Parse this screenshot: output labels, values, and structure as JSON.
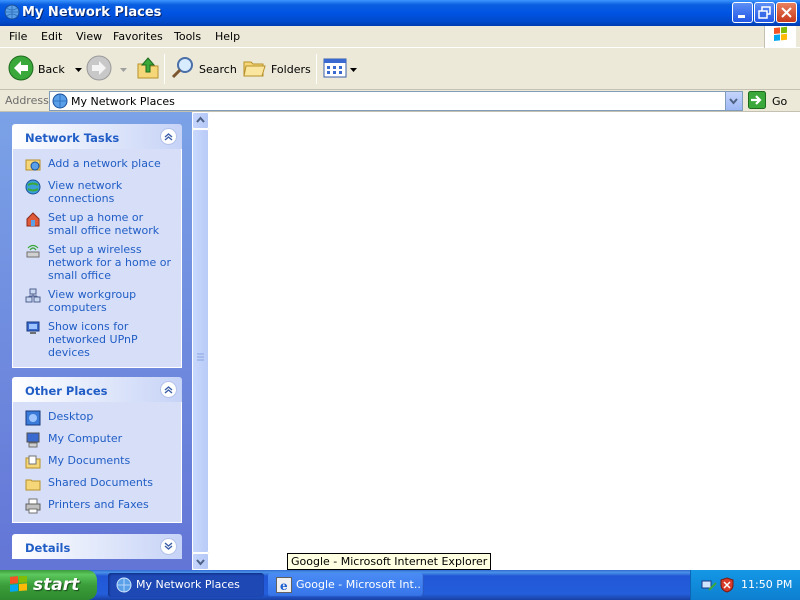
{
  "window": {
    "title": "My Network Places"
  },
  "menu": {
    "items": [
      "File",
      "Edit",
      "View",
      "Favorites",
      "Tools",
      "Help"
    ]
  },
  "toolbar": {
    "back_label": "Back",
    "search_label": "Search",
    "folders_label": "Folders"
  },
  "address": {
    "label": "Address",
    "value": "My Network Places",
    "go_label": "Go"
  },
  "network_tasks": {
    "title": "Network Tasks",
    "items": [
      {
        "label": "Add a network place",
        "icon": "add-network-place-icon"
      },
      {
        "label": "View network connections",
        "icon": "network-connections-icon"
      },
      {
        "label": "Set up a home or small office network",
        "icon": "home-network-icon"
      },
      {
        "label": "Set up a wireless network for a home or small office",
        "icon": "wireless-network-icon"
      },
      {
        "label": "View workgroup computers",
        "icon": "workgroup-icon"
      },
      {
        "label": "Show icons for networked UPnP devices",
        "icon": "upnp-icon"
      }
    ]
  },
  "other_places": {
    "title": "Other Places",
    "items": [
      {
        "label": "Desktop",
        "icon": "desktop-icon"
      },
      {
        "label": "My Computer",
        "icon": "my-computer-icon"
      },
      {
        "label": "My Documents",
        "icon": "my-documents-icon"
      },
      {
        "label": "Shared Documents",
        "icon": "shared-documents-icon"
      },
      {
        "label": "Printers and Faxes",
        "icon": "printer-icon"
      }
    ]
  },
  "details": {
    "title": "Details"
  },
  "tooltip": {
    "text": "Google - Microsoft Internet Explorer"
  },
  "taskbar": {
    "start_label": "start",
    "tasks": [
      {
        "label": "My Network Places",
        "active": true
      },
      {
        "label": "Google - Microsoft Int...",
        "active": false
      }
    ],
    "clock": "11:50 PM"
  },
  "colors": {
    "title_bar": "#0054e3",
    "task_pane": "#6375d6",
    "link": "#215dc6",
    "start_green": "#3a9e3a"
  }
}
